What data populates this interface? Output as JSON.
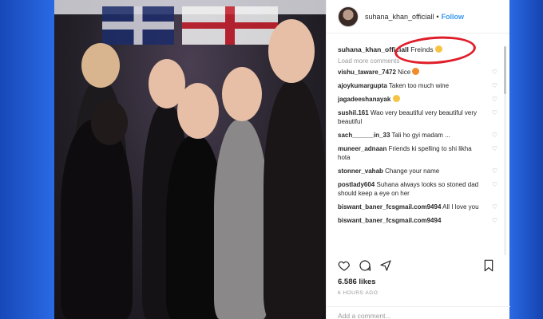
{
  "post": {
    "username": "suhana_khan_officiall",
    "separator": "•",
    "follow_label": "Follow",
    "caption": {
      "user": "suhana_khan_officiall",
      "text": "Freinds"
    },
    "load_more": "Load more comments",
    "comments": [
      {
        "user": "vishu_taware_7472",
        "text": "Nice"
      },
      {
        "user": "ajoykumargupta",
        "text": "Taken too much wine"
      },
      {
        "user": "jagadeeshanayak",
        "text": ""
      },
      {
        "user": "sushil.161",
        "text": "Wao very beautiful very beautiful very beautiful"
      },
      {
        "user": "sach______in_33",
        "text": "Tali ho gyi madam ..."
      },
      {
        "user": "muneer_adnaan",
        "text": "Friends ki spelling to shi likha hota"
      },
      {
        "user": "stonner_vahab",
        "text": "Change your name"
      },
      {
        "user": "postlady604",
        "text": "Suhana always looks so stoned dad should keep a eye on her"
      },
      {
        "user": "biswant_baner_fcsgmail.com9494",
        "text": "All I love you"
      },
      {
        "user": "biswant_baner_fcsgmail.com9494",
        "text": ""
      }
    ],
    "likes": "6.586 likes",
    "time_ago": "6 HOURS AGO",
    "add_comment_placeholder": "Add a comment..."
  },
  "colors": {
    "follow": "#3897f0",
    "highlight_circle": "#e01e2a",
    "background_blue": "#1f5fd6"
  },
  "icons": [
    "heart-icon",
    "comment-icon",
    "share-icon",
    "bookmark-icon"
  ]
}
